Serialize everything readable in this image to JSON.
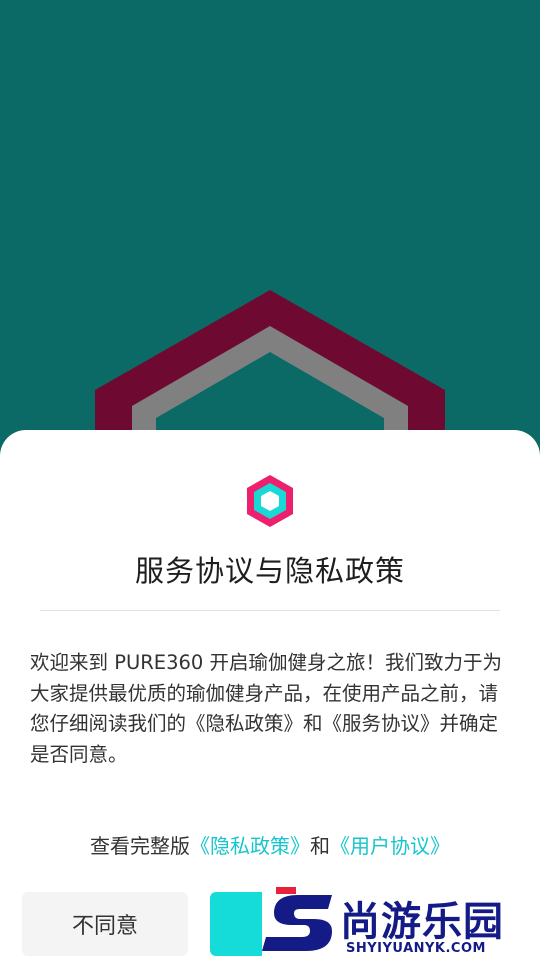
{
  "background": {
    "teal": "#0c6a66",
    "logo_outer": "#6e0a32",
    "logo_inner": "#808080"
  },
  "dialog": {
    "icon": "hexagon-app-icon",
    "title": "服务协议与隐私政策",
    "body": "欢迎来到 PURE360 开启瑜伽健身之旅！我们致力于为大家提供最优质的瑜伽健身产品，在使用产品之前，请您仔细阅读我们的《隐私政策》和《服务协议》并确定是否同意。",
    "links_prefix": "查看完整版",
    "privacy_link": "《隐私政策》",
    "links_joiner": "和",
    "user_agreement_link": "《用户协议》",
    "disagree_label": "不同意",
    "accent": "#16c6cc",
    "agree_color": "#15dcd8"
  },
  "watermark": {
    "logo_text": "尚游乐园",
    "url_text": "SHYIYUANYK.COM",
    "color": "#141b86"
  }
}
